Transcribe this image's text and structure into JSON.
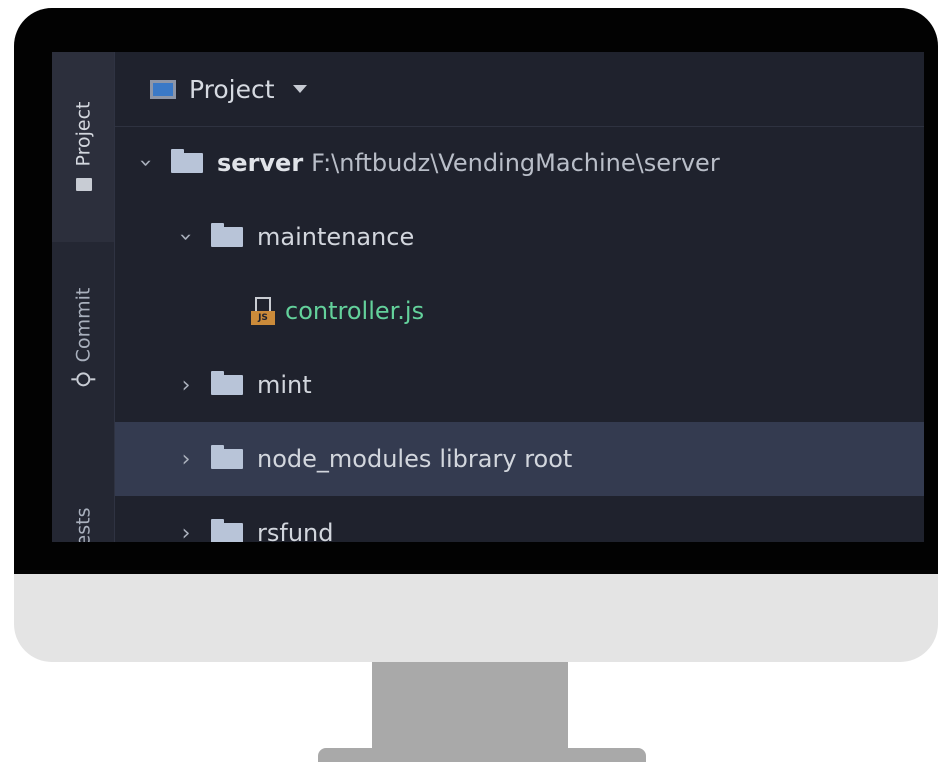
{
  "tool_window": {
    "tabs": [
      {
        "label": "Project",
        "icon": "folder-icon",
        "active": true
      },
      {
        "label": "Commit",
        "icon": "commit-icon",
        "active": false
      },
      {
        "label": "ests",
        "icon": "",
        "active": false
      }
    ]
  },
  "panel": {
    "title": "Project"
  },
  "tree": [
    {
      "expanded": true,
      "type": "folder",
      "name": "server",
      "suffix": "F:\\nftbudz\\VendingMachine\\server"
    },
    {
      "expanded": true,
      "type": "folder",
      "name": "maintenance",
      "suffix": ""
    },
    {
      "type": "file",
      "name": "controller.js",
      "icon_text": "JS",
      "suffix": ""
    },
    {
      "expanded": false,
      "type": "folder",
      "name": "mint",
      "suffix": ""
    },
    {
      "expanded": false,
      "type": "folder",
      "name": "node_modules",
      "suffix": "library root",
      "selected": true
    },
    {
      "expanded": false,
      "type": "folder",
      "name": "rsfund",
      "suffix": ""
    }
  ],
  "colors": {
    "screen_bg": "#1f222d",
    "selected_row": "#343b50",
    "file_green": "#63d19b",
    "js_badge": "#cb8b3a"
  }
}
